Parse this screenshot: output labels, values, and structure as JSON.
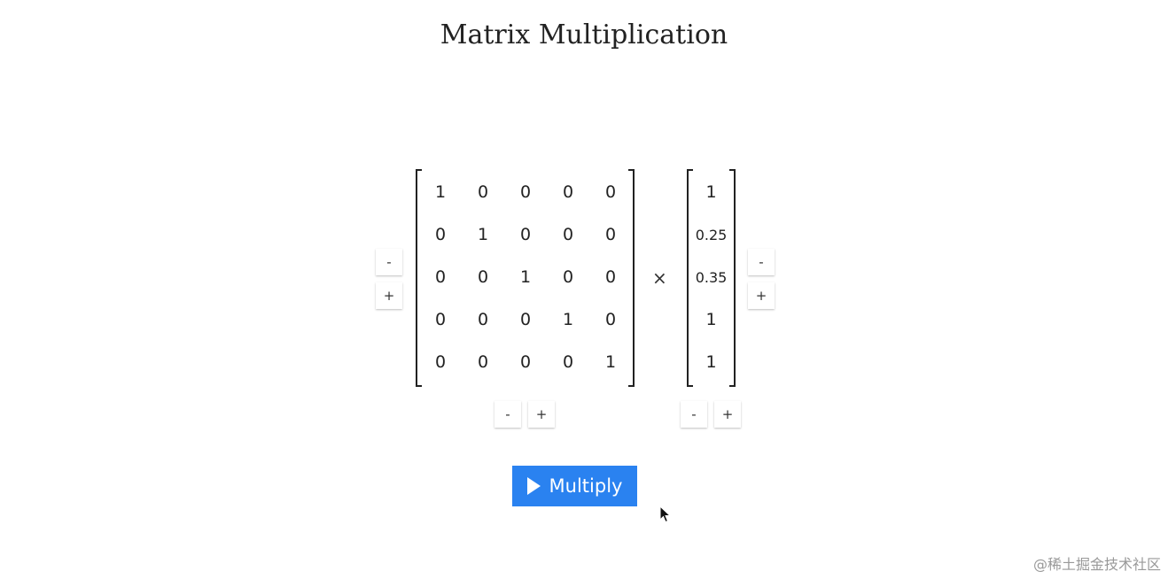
{
  "title": "Matrix Multiplication",
  "matrix_a": {
    "rows": [
      [
        "1",
        "0",
        "0",
        "0",
        "0"
      ],
      [
        "0",
        "1",
        "0",
        "0",
        "0"
      ],
      [
        "0",
        "0",
        "1",
        "0",
        "0"
      ],
      [
        "0",
        "0",
        "0",
        "1",
        "0"
      ],
      [
        "0",
        "0",
        "0",
        "0",
        "1"
      ]
    ]
  },
  "operator": "×",
  "matrix_b": {
    "rows": [
      [
        "1"
      ],
      [
        "0.25"
      ],
      [
        "0.35"
      ],
      [
        "1"
      ],
      [
        "1"
      ]
    ]
  },
  "controls": {
    "minus_label": "-",
    "plus_label": "+"
  },
  "multiply_button": {
    "label": "Multiply",
    "icon": "play-icon",
    "color": "#2a82f0"
  },
  "watermark": "@稀土掘金技术社区"
}
